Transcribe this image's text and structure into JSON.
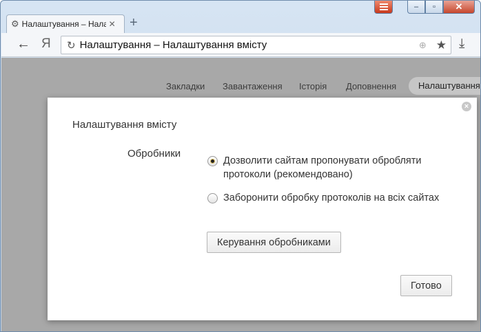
{
  "tab": {
    "title": "Налаштування – Нала",
    "icon": "⚙",
    "close": "✕"
  },
  "new_tab": "+",
  "toolbar": {
    "back": "←",
    "logo": "Я",
    "reload": "↻",
    "url": "Налаштування – Налаштування вмісту",
    "globe": "⊕",
    "star": "★",
    "download": "⤓"
  },
  "caption": {
    "menu": "",
    "minimize": "–",
    "maximize": "▫",
    "close": "✕"
  },
  "nav": {
    "items": [
      "Закладки",
      "Завантаження",
      "Історія",
      "Доповнення"
    ],
    "active": "Налаштування"
  },
  "dialog": {
    "title": "Налаштування вмісту",
    "close": "×",
    "section_label": "Обробники",
    "options": [
      {
        "label": "Дозволити сайтам пропонувати обробляти протоколи (рекомендовано)",
        "checked": true
      },
      {
        "label": "Заборонити обробку протоколів на всіх сайтах",
        "checked": false
      }
    ],
    "manage_button": "Керування обробниками",
    "done_button": "Готово"
  }
}
